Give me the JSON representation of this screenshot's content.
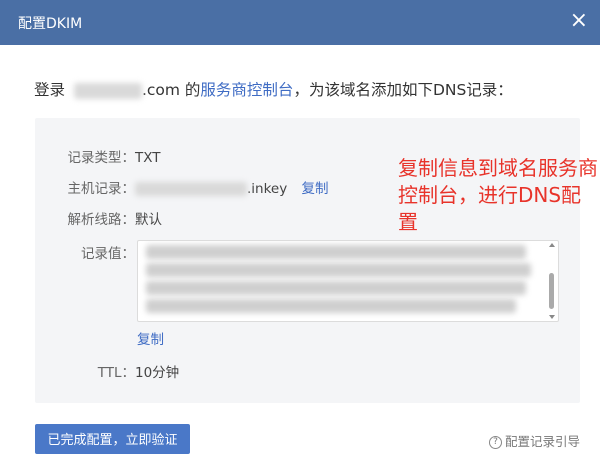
{
  "dialog": {
    "title": "配置DKIM",
    "close_label": "×"
  },
  "intro": {
    "prefix": "登录",
    "domain_suffix": ".com",
    "middle": " 的",
    "link": "服务商控制台",
    "suffix": "，为该域名添加如下DNS记录："
  },
  "record": {
    "type_label": "记录类型：",
    "type_value": "TXT",
    "host_label": "主机记录：",
    "host_value_suffix": ".inkey",
    "host_copy": "复制",
    "line_label": "解析线路：",
    "line_value": "默认",
    "value_label": "记录值：",
    "value_copy": "复制",
    "ttl_label": "TTL：",
    "ttl_value": "10分钟"
  },
  "annotation": "复制信息到域名服务商控制台，进行DNS配置",
  "footer": {
    "confirm_button": "已完成配置，立即验证",
    "guide_icon": "?",
    "guide_link": "配置记录引导"
  },
  "colors": {
    "header": "#4a6fa5",
    "primary": "#4a78c8",
    "link": "#3f6cc4",
    "annotation": "#e8332a"
  }
}
